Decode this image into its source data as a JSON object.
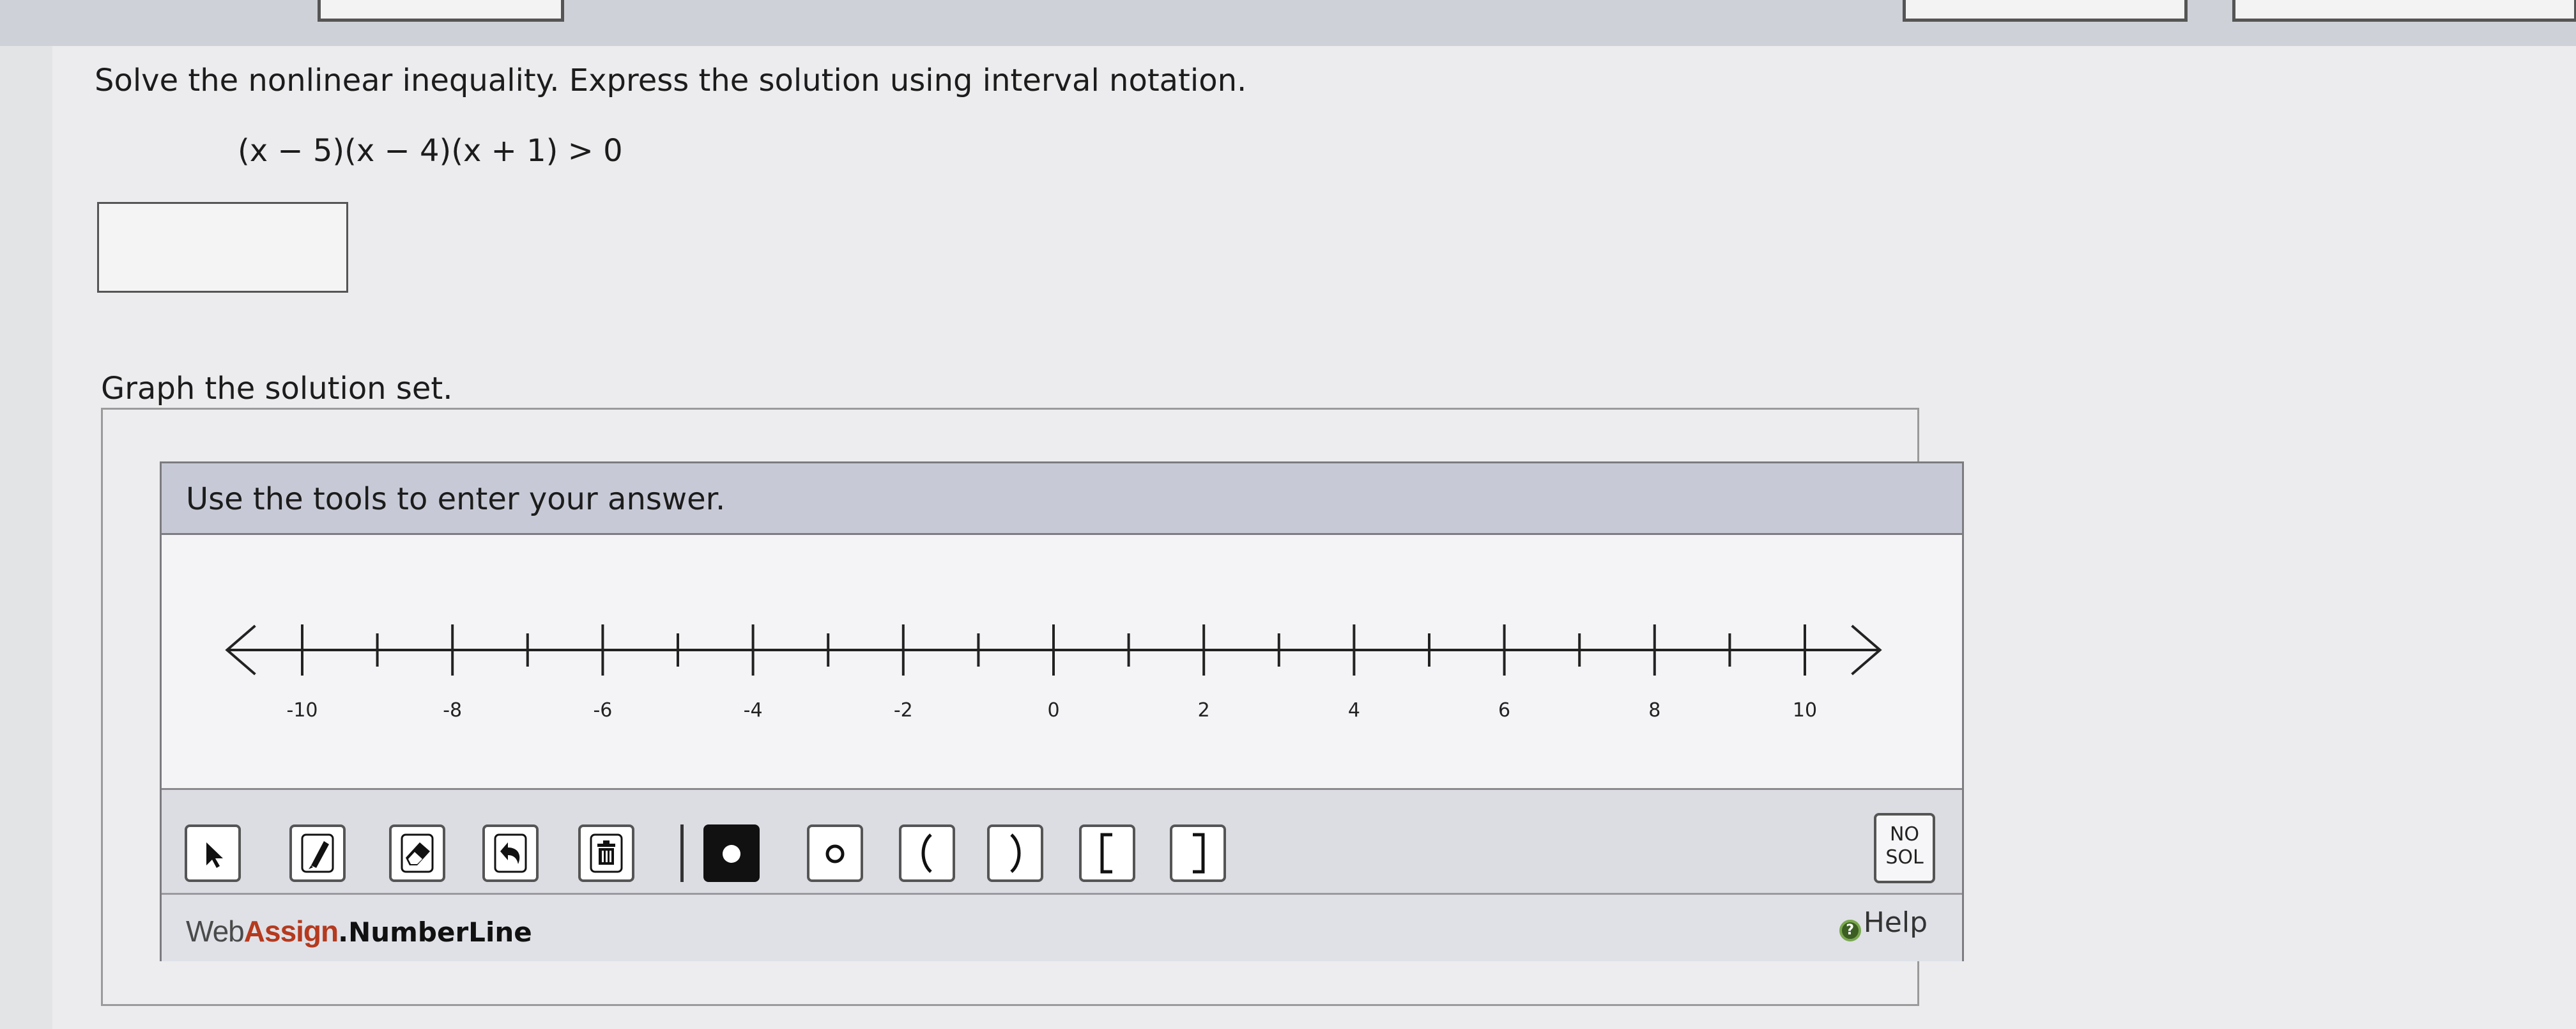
{
  "question": {
    "instruction": "Solve the nonlinear inequality. Express the solution using interval notation.",
    "expression": "(x − 5)(x − 4)(x + 1) > 0",
    "answer_value": ""
  },
  "graph": {
    "label": "Graph the solution set.",
    "instructions": "Use the tools to enter your answer.",
    "axis": {
      "min": -11,
      "max": 11,
      "tick_step": 1,
      "labels": [
        "-10",
        "-8",
        "-6",
        "-4",
        "-2",
        "0",
        "2",
        "4",
        "6",
        "8",
        "10"
      ]
    }
  },
  "toolbar": {
    "tools": [
      {
        "name": "pointer-tool",
        "icon": "pointer-icon"
      },
      {
        "name": "draw-tool",
        "icon": "pencil-icon"
      },
      {
        "name": "eraser-tool",
        "icon": "eraser-icon"
      },
      {
        "name": "undo-tool",
        "icon": "undo-icon"
      },
      {
        "name": "delete-tool",
        "icon": "trash-icon"
      },
      {
        "name": "closed-dot-tool",
        "icon": "closed-dot-icon",
        "selected": true
      },
      {
        "name": "open-dot-tool",
        "icon": "open-dot-icon"
      },
      {
        "name": "left-paren-tool",
        "icon": "left-parenthesis-icon"
      },
      {
        "name": "right-paren-tool",
        "icon": "right-parenthesis-icon"
      },
      {
        "name": "left-bracket-tool",
        "icon": "left-bracket-icon"
      },
      {
        "name": "right-bracket-tool",
        "icon": "right-bracket-icon"
      }
    ],
    "no_solution_line1": "NO",
    "no_solution_line2": "SOL"
  },
  "footer": {
    "brand_web": "Web",
    "brand_assign": "Assign",
    "brand_product": "NumberLine",
    "help_label": "Help"
  },
  "colors": {
    "brand_accent": "#b53a1e",
    "header_band": "#c7cad6",
    "help_icon": "#3b5e22"
  }
}
